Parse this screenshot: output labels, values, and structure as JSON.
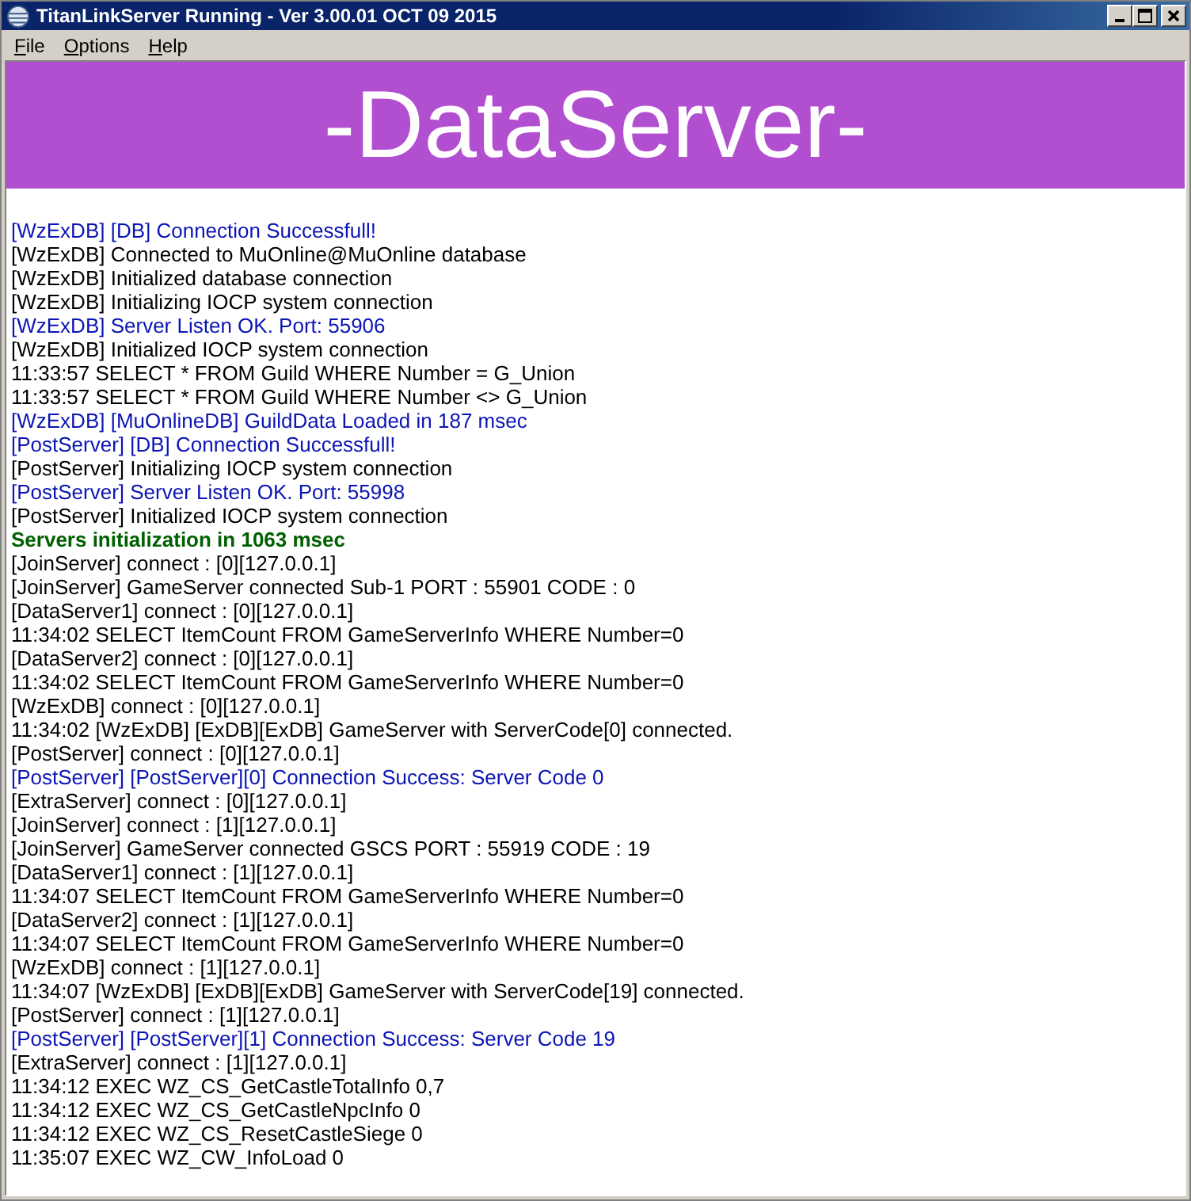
{
  "window": {
    "title": "TitanLinkServer Running - Ver 3.00.01 OCT 09 2015"
  },
  "menu": [
    "File",
    "Options",
    "Help"
  ],
  "banner": {
    "text": "-DataServer-"
  },
  "log": [
    {
      "kind": "notice",
      "text": "[WzExDB] [DB] Connection Successfull!"
    },
    {
      "kind": "plain",
      "text": "[WzExDB] Connected to MuOnline@MuOnline database"
    },
    {
      "kind": "plain",
      "text": "[WzExDB] Initialized database connection"
    },
    {
      "kind": "plain",
      "text": "[WzExDB] Initializing IOCP system connection"
    },
    {
      "kind": "notice",
      "text": "[WzExDB] Server Listen OK. Port: 55906"
    },
    {
      "kind": "plain",
      "text": "[WzExDB] Initialized IOCP system connection"
    },
    {
      "kind": "plain",
      "text": "11:33:57 SELECT * FROM Guild WHERE Number = G_Union"
    },
    {
      "kind": "plain",
      "text": "11:33:57 SELECT * FROM Guild WHERE Number <> G_Union"
    },
    {
      "kind": "notice",
      "text": "[WzExDB] [MuOnlineDB] GuildData Loaded in 187 msec"
    },
    {
      "kind": "notice",
      "text": "[PostServer] [DB] Connection Successfull!"
    },
    {
      "kind": "plain",
      "text": "[PostServer] Initializing IOCP system connection"
    },
    {
      "kind": "notice",
      "text": "[PostServer] Server Listen OK. Port: 55998"
    },
    {
      "kind": "plain",
      "text": "[PostServer] Initialized IOCP system connection"
    },
    {
      "kind": "success",
      "text": "Servers initialization in 1063 msec"
    },
    {
      "kind": "plain",
      "text": "[JoinServer] connect : [0][127.0.0.1]"
    },
    {
      "kind": "plain",
      "text": "[JoinServer] GameServer connected Sub-1 PORT : 55901 CODE : 0"
    },
    {
      "kind": "plain",
      "text": "[DataServer1] connect : [0][127.0.0.1]"
    },
    {
      "kind": "plain",
      "text": "11:34:02 SELECT ItemCount FROM GameServerInfo WHERE Number=0"
    },
    {
      "kind": "plain",
      "text": "[DataServer2] connect : [0][127.0.0.1]"
    },
    {
      "kind": "plain",
      "text": "11:34:02 SELECT ItemCount FROM GameServerInfo WHERE Number=0"
    },
    {
      "kind": "plain",
      "text": "[WzExDB] connect : [0][127.0.0.1]"
    },
    {
      "kind": "plain",
      "text": "11:34:02 [WzExDB] [ExDB][ExDB] GameServer with ServerCode[0] connected."
    },
    {
      "kind": "plain",
      "text": "[PostServer] connect : [0][127.0.0.1]"
    },
    {
      "kind": "notice",
      "text": "[PostServer] [PostServer][0] Connection Success: Server Code 0"
    },
    {
      "kind": "plain",
      "text": "[ExtraServer] connect : [0][127.0.0.1]"
    },
    {
      "kind": "plain",
      "text": "[JoinServer] connect : [1][127.0.0.1]"
    },
    {
      "kind": "plain",
      "text": "[JoinServer] GameServer connected GSCS PORT : 55919 CODE : 19"
    },
    {
      "kind": "plain",
      "text": "[DataServer1] connect : [1][127.0.0.1]"
    },
    {
      "kind": "plain",
      "text": "11:34:07 SELECT ItemCount FROM GameServerInfo WHERE Number=0"
    },
    {
      "kind": "plain",
      "text": "[DataServer2] connect : [1][127.0.0.1]"
    },
    {
      "kind": "plain",
      "text": "11:34:07 SELECT ItemCount FROM GameServerInfo WHERE Number=0"
    },
    {
      "kind": "plain",
      "text": "[WzExDB] connect : [1][127.0.0.1]"
    },
    {
      "kind": "plain",
      "text": "11:34:07 [WzExDB] [ExDB][ExDB] GameServer with ServerCode[19] connected."
    },
    {
      "kind": "plain",
      "text": "[PostServer] connect : [1][127.0.0.1]"
    },
    {
      "kind": "notice",
      "text": "[PostServer] [PostServer][1] Connection Success: Server Code 19"
    },
    {
      "kind": "plain",
      "text": "[ExtraServer] connect : [1][127.0.0.1]"
    },
    {
      "kind": "plain",
      "text": "11:34:12 EXEC WZ_CS_GetCastleTotalInfo 0,7"
    },
    {
      "kind": "plain",
      "text": "11:34:12 EXEC WZ_CS_GetCastleNpcInfo 0"
    },
    {
      "kind": "plain",
      "text": "11:34:12 EXEC WZ_CS_ResetCastleSiege 0"
    },
    {
      "kind": "plain",
      "text": "11:35:07 EXEC WZ_CW_InfoLoad 0"
    }
  ]
}
